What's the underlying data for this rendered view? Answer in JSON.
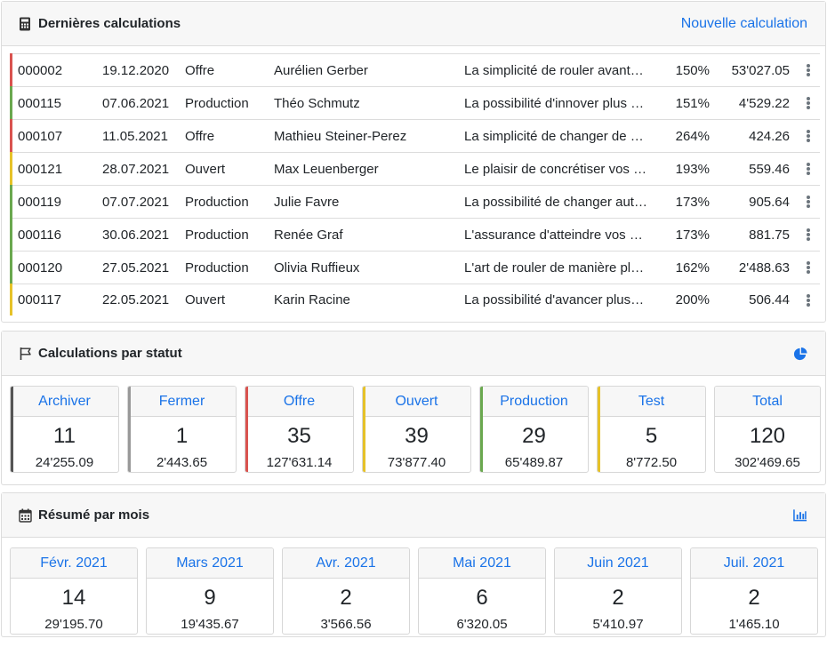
{
  "recent": {
    "title": "Dernières calculations",
    "new_link": "Nouvelle calculation",
    "colors": {
      "red": "#d9534f",
      "green": "#5cb85c",
      "yellow": "#f0c419"
    },
    "rows": [
      {
        "id": "000002",
        "date": "19.12.2020",
        "status": "Offre",
        "name": "Aurélien Gerber",
        "desc": "La simplicité de rouler avant-gardiste",
        "pct": "150%",
        "amount": "53'027.05",
        "color": "#d9534f"
      },
      {
        "id": "000115",
        "date": "07.06.2021",
        "status": "Production",
        "name": "Théo Schmutz",
        "desc": "La possibilité d'innover plus facilement",
        "pct": "151%",
        "amount": "4'529.22",
        "color": "#6aa84f"
      },
      {
        "id": "000107",
        "date": "11.05.2021",
        "status": "Offre",
        "name": "Mathieu Steiner-Perez",
        "desc": "La simplicité de changer de manière sûre",
        "pct": "264%",
        "amount": "424.26",
        "color": "#d9534f"
      },
      {
        "id": "000121",
        "date": "28.07.2021",
        "status": "Ouvert",
        "name": "Max Leuenberger",
        "desc": "Le plaisir de concrétiser vos projets",
        "pct": "193%",
        "amount": "559.46",
        "color": "#e6c229"
      },
      {
        "id": "000119",
        "date": "07.07.2021",
        "status": "Production",
        "name": "Julie Favre",
        "desc": "La possibilité de changer autrement",
        "pct": "173%",
        "amount": "905.64",
        "color": "#6aa84f"
      },
      {
        "id": "000116",
        "date": "30.06.2021",
        "status": "Production",
        "name": "Renée Graf",
        "desc": "L'assurance d'atteindre vos objectifs",
        "pct": "173%",
        "amount": "881.75",
        "color": "#6aa84f"
      },
      {
        "id": "000120",
        "date": "27.05.2021",
        "status": "Production",
        "name": "Olivia Ruffieux",
        "desc": "L'art de rouler de manière plus sûre",
        "pct": "162%",
        "amount": "2'488.63",
        "color": "#6aa84f"
      },
      {
        "id": "000117",
        "date": "22.05.2021",
        "status": "Ouvert",
        "name": "Karin Racine",
        "desc": "La possibilité d'avancer plus rapidement",
        "pct": "200%",
        "amount": "506.44",
        "color": "#e6c229"
      }
    ]
  },
  "by_status": {
    "title": "Calculations par statut",
    "boxes": [
      {
        "label": "Archiver",
        "count": "11",
        "amount": "24'255.09",
        "color": "#555555"
      },
      {
        "label": "Fermer",
        "count": "1",
        "amount": "2'443.65",
        "color": "#999999"
      },
      {
        "label": "Offre",
        "count": "35",
        "amount": "127'631.14",
        "color": "#d9534f"
      },
      {
        "label": "Ouvert",
        "count": "39",
        "amount": "73'877.40",
        "color": "#e6c229"
      },
      {
        "label": "Production",
        "count": "29",
        "amount": "65'489.87",
        "color": "#6aa84f"
      },
      {
        "label": "Test",
        "count": "5",
        "amount": "8'772.50",
        "color": "#e6c229"
      },
      {
        "label": "Total",
        "count": "120",
        "amount": "302'469.65",
        "color": ""
      }
    ]
  },
  "by_month": {
    "title": "Résumé par mois",
    "boxes": [
      {
        "label": "Févr. 2021",
        "count": "14",
        "amount": "29'195.70"
      },
      {
        "label": "Mars 2021",
        "count": "9",
        "amount": "19'435.67"
      },
      {
        "label": "Avr. 2021",
        "count": "2",
        "amount": "3'566.56"
      },
      {
        "label": "Mai 2021",
        "count": "6",
        "amount": "6'320.05"
      },
      {
        "label": "Juin 2021",
        "count": "2",
        "amount": "5'410.97"
      },
      {
        "label": "Juil. 2021",
        "count": "2",
        "amount": "1'465.10"
      }
    ]
  },
  "icons": {
    "calculator": "calculator-icon",
    "flag": "flag-icon",
    "pie": "pie-chart-icon",
    "calendar": "calendar-icon",
    "bar": "bar-chart-icon",
    "menu": "kebab-menu-icon"
  },
  "accent": "#1a73e8"
}
